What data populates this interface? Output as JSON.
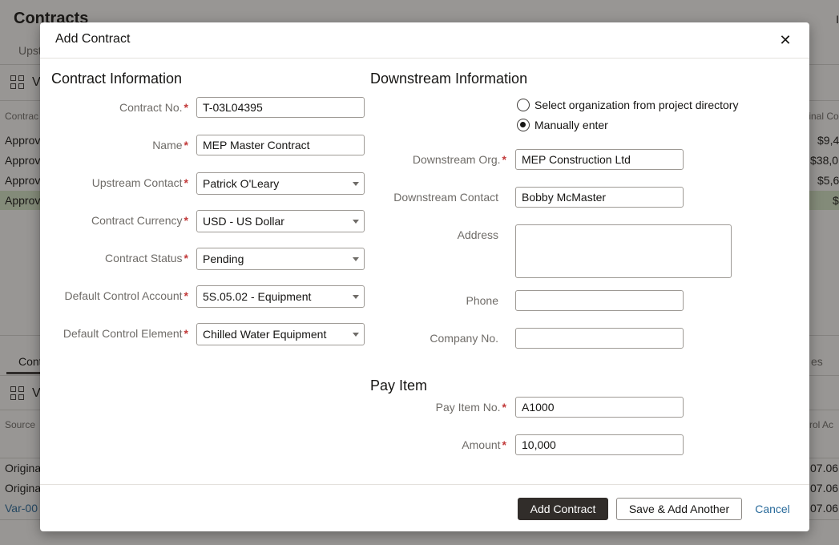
{
  "background": {
    "title": "Contracts",
    "top_right_initial": "I",
    "subtab": "Upst",
    "upper_view_label": "V",
    "upper_header_left": "Contrac",
    "upper_header_right": "iginal Co",
    "upper_rows": [
      {
        "status": "Approv",
        "amount": "$9,4"
      },
      {
        "status": "Approv",
        "amount": "$38,0"
      },
      {
        "status": "Approv",
        "amount": "$5,6"
      },
      {
        "status": "Approv",
        "amount": "$"
      }
    ],
    "lower_tab": "Cont",
    "lower_right_tab": "es",
    "lower_view_label": "V",
    "lower_header_left": "Source",
    "lower_header_right": "ntrol Ac",
    "lower_rows": [
      {
        "source": "Origina",
        "value": "07.06"
      },
      {
        "source": "Origina",
        "value": "07.06"
      },
      {
        "source": "Var-00",
        "value": "07.06"
      }
    ]
  },
  "dialog": {
    "title": "Add Contract",
    "close_glyph": "✕",
    "contract_info": {
      "heading": "Contract Information",
      "fields": {
        "contract_no": {
          "label": "Contract No.",
          "value": "T-03L04395"
        },
        "name": {
          "label": "Name",
          "value": "MEP Master Contract"
        },
        "upstream_contact": {
          "label": "Upstream Contact",
          "value": "Patrick O'Leary"
        },
        "contract_currency": {
          "label": "Contract Currency",
          "value": "USD - US Dollar"
        },
        "contract_status": {
          "label": "Contract Status",
          "value": "Pending"
        },
        "default_control_account": {
          "label": "Default Control Account",
          "value": "5S.05.02 - Equipment"
        },
        "default_control_element": {
          "label": "Default Control Element",
          "value": "Chilled Water Equipment"
        }
      }
    },
    "downstream_info": {
      "heading": "Downstream Information",
      "radio_select_org": "Select organization from project directory",
      "radio_manual": "Manually enter",
      "selected_option": "manual",
      "fields": {
        "downstream_org": {
          "label": "Downstream Org.",
          "value": "MEP Construction Ltd"
        },
        "downstream_contact": {
          "label": "Downstream Contact",
          "value": "Bobby McMaster"
        },
        "address": {
          "label": "Address",
          "value": ""
        },
        "phone": {
          "label": "Phone",
          "value": ""
        },
        "company_no": {
          "label": "Company No.",
          "value": ""
        }
      }
    },
    "pay_item": {
      "heading": "Pay Item",
      "fields": {
        "pay_item_no": {
          "label": "Pay Item No.",
          "value": "A1000"
        },
        "amount": {
          "label": "Amount",
          "value": "10,000"
        }
      }
    },
    "required_marker": "*",
    "footer": {
      "add_contract": "Add Contract",
      "save_add_another": "Save & Add Another",
      "cancel": "Cancel"
    }
  },
  "colors": {
    "primary_button": "#312d2a",
    "link": "#2a6b9b",
    "required": "#c23a3a",
    "approved_row": "#d5e5c6"
  }
}
